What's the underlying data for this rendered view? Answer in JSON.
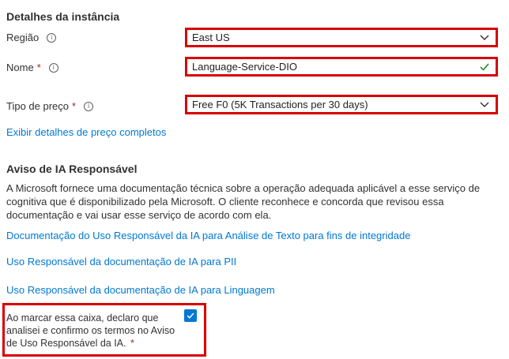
{
  "instance": {
    "section_title": "Detalhes da instância",
    "region": {
      "label": "Região",
      "value": "East US"
    },
    "name": {
      "label": "Nome",
      "required_mark": "*",
      "value": "Language-Service-DIO"
    },
    "pricing": {
      "label": "Tipo de preço",
      "required_mark": "*",
      "value": "Free F0 (5K Transactions per 30 days)"
    },
    "pricing_link": "Exibir detalhes de preço completos"
  },
  "responsible_ai": {
    "section_title": "Aviso de IA Responsável",
    "description": "A Microsoft fornece uma documentação técnica sobre a operação adequada aplicável a esse serviço de cognitiva que é disponibilizado pela Microsoft. O cliente reconhece e concorda que revisou essa documentação e vai usar esse serviço de acordo com ela.",
    "links": [
      "Documentação do Uso Responsável da IA para Análise de Texto para fins de integridade",
      "Uso Responsável da documentação de IA para PII",
      "Uso Responsável da documentação de IA para Linguagem"
    ],
    "consent": {
      "text": "Ao marcar essa caixa, declaro que analisei e confirmo os termos no Aviso de Uso Responsável da IA.",
      "required_mark": "*",
      "checked": true
    }
  },
  "colors": {
    "accent": "#0078d4",
    "highlight_border": "#d80000",
    "valid_check": "#107c10",
    "required": "#a4262c"
  },
  "icons": {
    "info": "info-circle-icon",
    "dropdown": "chevron-down-icon",
    "valid": "checkmark-icon",
    "checkbox": "checkbox-checked-icon"
  }
}
